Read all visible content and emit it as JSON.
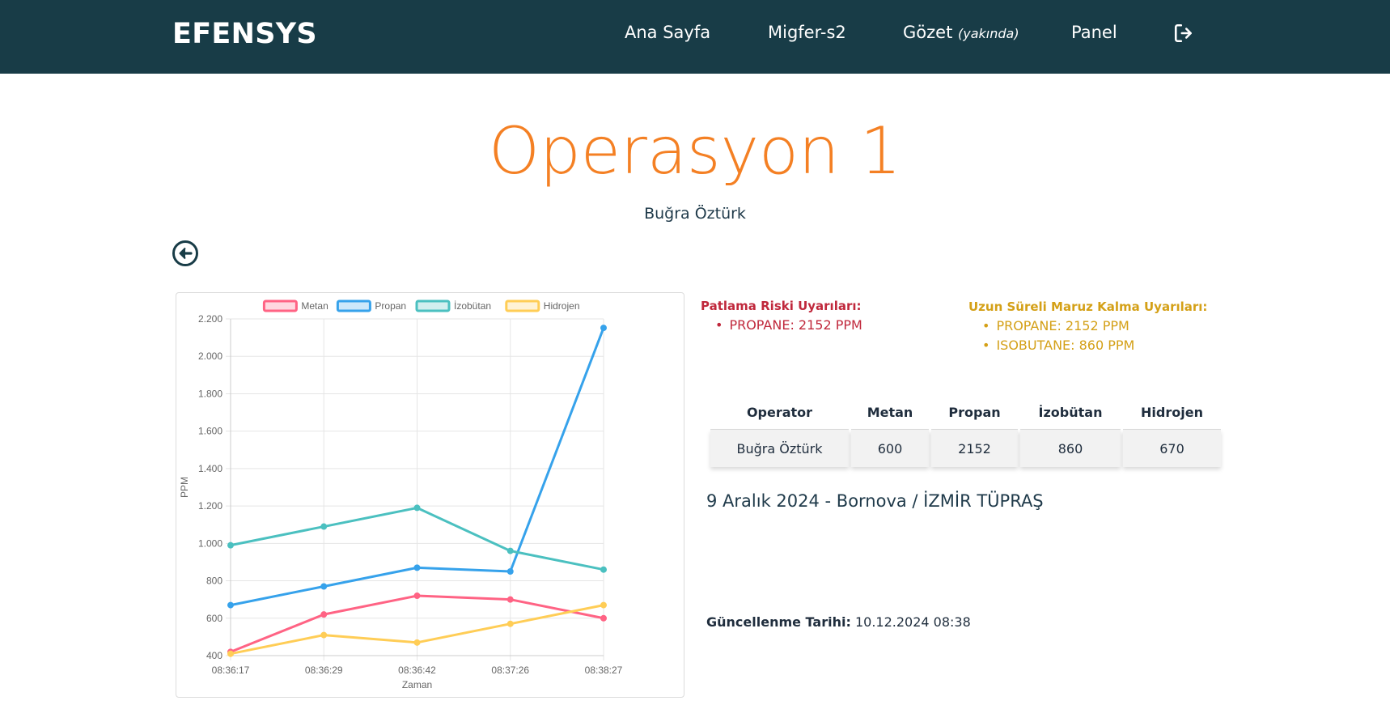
{
  "nav": {
    "brand": "EFENSYS",
    "links": [
      "Ana Sayfa",
      "Migfer-s2",
      "Gözet",
      "Panel"
    ],
    "soon": "(yakında)",
    "logout_icon": "sign-out-icon"
  },
  "page": {
    "title": "Operasyon 1",
    "subtitle": "Buğra Öztürk",
    "back_icon": "arrow-left-circle-icon"
  },
  "alerts": {
    "explosion_title": "Patlama Riski Uyarıları:",
    "explosion_items": [
      "PROPANE: 2152 PPM"
    ],
    "exposure_title": "Uzun Süreli Maruz Kalma Uyarıları:",
    "exposure_items": [
      "PROPANE: 2152 PPM",
      "ISOBUTANE: 860 PPM"
    ]
  },
  "table": {
    "headers": [
      "Operator",
      "Metan",
      "Propan",
      "İzobütan",
      "Hidrojen"
    ],
    "rows": [
      [
        "Buğra Öztürk",
        "600",
        "2152",
        "860",
        "670"
      ]
    ]
  },
  "location": "9 Aralık 2024 - Bornova / İZMİR TÜPRAŞ",
  "updated": {
    "label": "Güncellenme Tarihi:",
    "value": "10.12.2024 08:38"
  },
  "colors": {
    "navbar": "#183c47",
    "title": "#f48024",
    "danger": "#c0283c",
    "warning": "#d4a017"
  },
  "chart_data": {
    "type": "line",
    "categories": [
      "08:36:17",
      "08:36:29",
      "08:36:42",
      "08:37:26",
      "08:38:27"
    ],
    "series": [
      {
        "name": "Metan",
        "color": "#ff6384",
        "values": [
          420,
          620,
          720,
          700,
          600
        ]
      },
      {
        "name": "Propan",
        "color": "#36a2eb",
        "values": [
          670,
          770,
          870,
          850,
          2152
        ]
      },
      {
        "name": "İzobütan",
        "color": "#4bc0c0",
        "values": [
          990,
          1090,
          1190,
          960,
          860
        ]
      },
      {
        "name": "Hidrojen",
        "color": "#ffcd56",
        "values": [
          410,
          510,
          470,
          570,
          670
        ]
      }
    ],
    "yticks": [
      "400",
      "600",
      "800",
      "1.000",
      "1.200",
      "1.400",
      "1.600",
      "1.800",
      "2.000",
      "2.200"
    ],
    "ylim": [
      400,
      2200
    ],
    "xlabel": "Zaman",
    "ylabel": "PPM",
    "grid": true,
    "legend_position": "top"
  }
}
